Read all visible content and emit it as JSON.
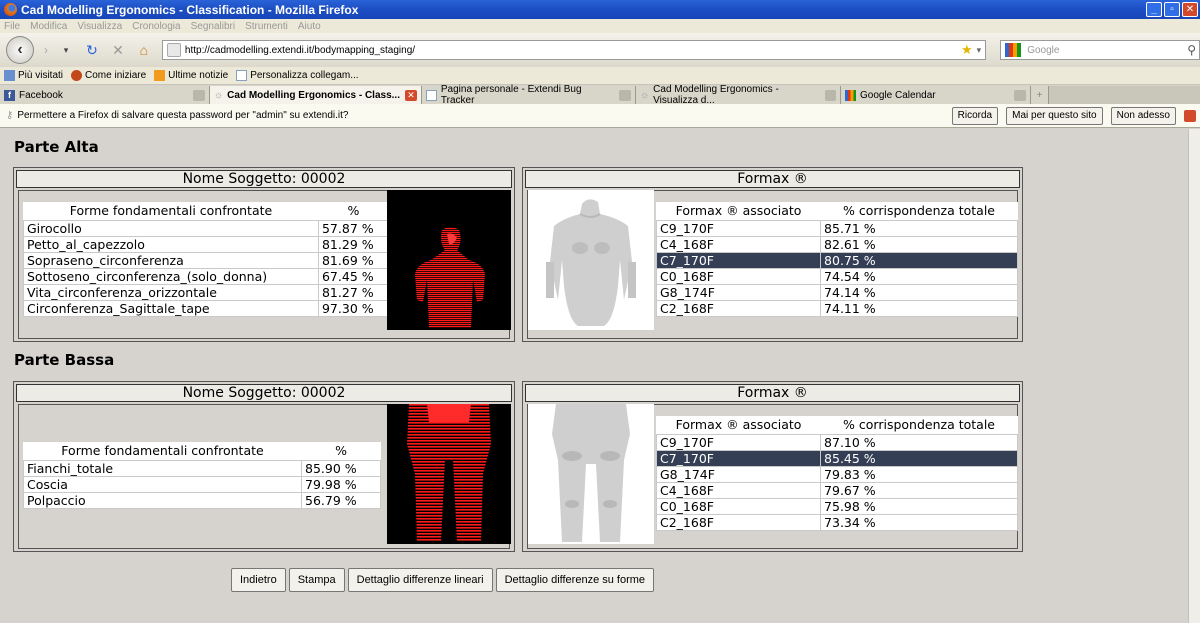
{
  "window": {
    "title": "Cad Modelling Ergonomics - Classification - Mozilla Firefox"
  },
  "menu": [
    "File",
    "Modifica",
    "Visualizza",
    "Cronologia",
    "Segnalibri",
    "Strumenti",
    "Aiuto"
  ],
  "nav": {
    "url": "http://cadmodelling.extendi.it/bodymapping_staging/",
    "search_placeholder": "Google"
  },
  "bookmarks": [
    "Più visitati",
    "Come iniziare",
    "Ultime notizie",
    "Personalizza collegam..."
  ],
  "tabs": [
    {
      "label": "Facebook"
    },
    {
      "label": "Cad Modelling Ergonomics - Class..."
    },
    {
      "label": "Pagina personale - Extendi Bug Tracker"
    },
    {
      "label": "Cad Modelling Ergonomics - Visualizza d..."
    },
    {
      "label": "Google Calendar"
    }
  ],
  "notification": {
    "text": "Permettere a Firefox di salvare questa password per \"admin\" su extendi.it?",
    "remember": "Ricorda",
    "never": "Mai per questo sito",
    "not_now": "Non adesso"
  },
  "upper": {
    "title": "Parte Alta",
    "subject_header": "Nome Soggetto: 00002",
    "formax_header": "Formax ®",
    "measures_col": "Forme fondamentali confrontate",
    "pct_col": "%",
    "measures": [
      {
        "name": "Girocollo",
        "pct": "57.87 %"
      },
      {
        "name": "Petto_al_capezzolo",
        "pct": "81.29 %"
      },
      {
        "name": "Sopraseno_circonferenza",
        "pct": "81.69 %"
      },
      {
        "name": "Sottoseno_circonferenza_(solo_donna)",
        "pct": "67.45 %"
      },
      {
        "name": "Vita_circonferenza_orizzontale",
        "pct": "81.27 %"
      },
      {
        "name": "Circonferenza_Sagittale_tape",
        "pct": "97.30 %"
      }
    ],
    "formax_col": "Formax ® associato",
    "total_col": "% corrispondenza totale",
    "formax": [
      {
        "code": "C9_170F",
        "pct": "85.71 %"
      },
      {
        "code": "C4_168F",
        "pct": "82.61 %"
      },
      {
        "code": "C7_170F",
        "pct": "80.75 %"
      },
      {
        "code": "C0_168F",
        "pct": "74.54 %"
      },
      {
        "code": "G8_174F",
        "pct": "74.14 %"
      },
      {
        "code": "C2_168F",
        "pct": "74.11 %"
      }
    ]
  },
  "lower": {
    "title": "Parte Bassa",
    "subject_header": "Nome Soggetto: 00002",
    "formax_header": "Formax ®",
    "measures_col": "Forme fondamentali confrontate",
    "pct_col": "%",
    "measures": [
      {
        "name": "Fianchi_totale",
        "pct": "85.90 %"
      },
      {
        "name": "Coscia",
        "pct": "79.98 %"
      },
      {
        "name": "Polpaccio",
        "pct": "56.79 %"
      }
    ],
    "formax_col": "Formax ® associato",
    "total_col": "% corrispondenza totale",
    "formax": [
      {
        "code": "C9_170F",
        "pct": "87.10 %"
      },
      {
        "code": "C7_170F",
        "pct": "85.45 %"
      },
      {
        "code": "G8_174F",
        "pct": "79.83 %"
      },
      {
        "code": "C4_168F",
        "pct": "79.67 %"
      },
      {
        "code": "C0_168F",
        "pct": "75.98 %"
      },
      {
        "code": "C2_168F",
        "pct": "73.34 %"
      }
    ]
  },
  "actions": {
    "back": "Indietro",
    "print": "Stampa",
    "linear": "Dettaglio differenze lineari",
    "shapes": "Dettaglio differenze su forme"
  }
}
